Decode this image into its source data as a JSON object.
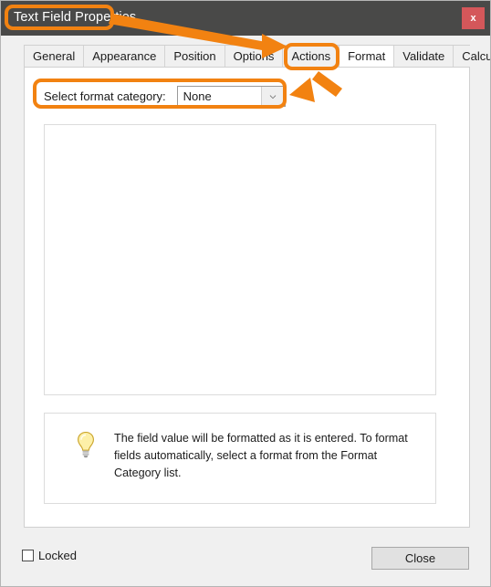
{
  "window": {
    "title": "Text Field Properties",
    "close_icon_label": "x"
  },
  "tabs": [
    {
      "label": "General",
      "selected": false
    },
    {
      "label": "Appearance",
      "selected": false
    },
    {
      "label": "Position",
      "selected": false
    },
    {
      "label": "Options",
      "selected": false
    },
    {
      "label": "Actions",
      "selected": false
    },
    {
      "label": "Format",
      "selected": true
    },
    {
      "label": "Validate",
      "selected": false
    },
    {
      "label": "Calculate",
      "selected": false
    }
  ],
  "format_tab": {
    "category_label": "Select format category:",
    "category_value": "None",
    "category_options": [
      "None"
    ],
    "info_text": "The field value will be formatted as it is entered. To format fields automatically, select a format from the Format Category list."
  },
  "footer": {
    "locked_label": "Locked",
    "locked_checked": false,
    "close_label": "Close"
  },
  "annotations": {
    "highlight_color": "#f28211",
    "boxes": [
      "window-title",
      "format-tab",
      "select-format-category-row"
    ],
    "arrows": [
      {
        "from": "window-title-box",
        "to": "format-tab"
      },
      {
        "from": "format-tab",
        "to": "select-format-category-row"
      }
    ]
  },
  "colors": {
    "titlebar": "#494948",
    "close_button": "#d4575a",
    "dialog_background": "#f0f0f0",
    "panel_background": "#ffffff",
    "accent_orange": "#f28211"
  }
}
